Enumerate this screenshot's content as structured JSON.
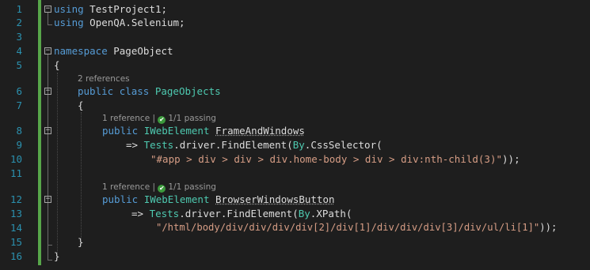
{
  "line_numbers": [
    "1",
    "2",
    "3",
    "4",
    "5",
    "6",
    "7",
    "8",
    "9",
    "10",
    "11",
    "12",
    "13",
    "14",
    "15",
    "16"
  ],
  "code": {
    "l1": {
      "kw": "using",
      "rest": " TestProject1;"
    },
    "l2": {
      "kw": "using",
      "rest": " OpenQA.Selenium;"
    },
    "l4": {
      "kw": "namespace",
      "rest": " PageObject"
    },
    "l5": "{",
    "lens_class": "2 references",
    "l6": {
      "kw1": "public",
      "kw2": "class",
      "type": "PageObjects"
    },
    "l7": "{",
    "lens_m1": {
      "refs": "1 reference",
      "sep": " | ",
      "passing": "1/1 passing",
      "check": "✔"
    },
    "l8": {
      "kw": "public",
      "type": "IWebElement",
      "name": "FrameAndWindows"
    },
    "l9": {
      "arrow": "=> ",
      "tests": "Tests",
      "d1": ".driver.FindElement(",
      "by": "By",
      "d2": ".CssSelector("
    },
    "l10": {
      "str": "\"#app > div > div > div.home-body > div > div:nth-child(3)\"",
      "end": "));"
    },
    "lens_m2": {
      "refs": "1 reference",
      "sep": " | ",
      "passing": "1/1 passing",
      "check": "✔"
    },
    "l12": {
      "kw": "public",
      "type": "IWebElement",
      "name": "BrowserWindowsButton"
    },
    "l13": {
      "arrow": "=> ",
      "tests": "Tests",
      "d1": ".driver.FindElement(",
      "by": "By",
      "d2": ".XPath("
    },
    "l14": {
      "str": "\"/html/body/div/div/div/div[2]/div[1]/div/div/div[3]/div/ul/li[1]\"",
      "end": "));"
    },
    "l15": "}",
    "l16": "}"
  },
  "colors": {
    "background": "#1e1e1e",
    "line_number": "#2b91af",
    "keyword": "#569cd6",
    "type": "#4ec9b0",
    "string": "#d69d85",
    "change_bar": "#57a64a"
  }
}
